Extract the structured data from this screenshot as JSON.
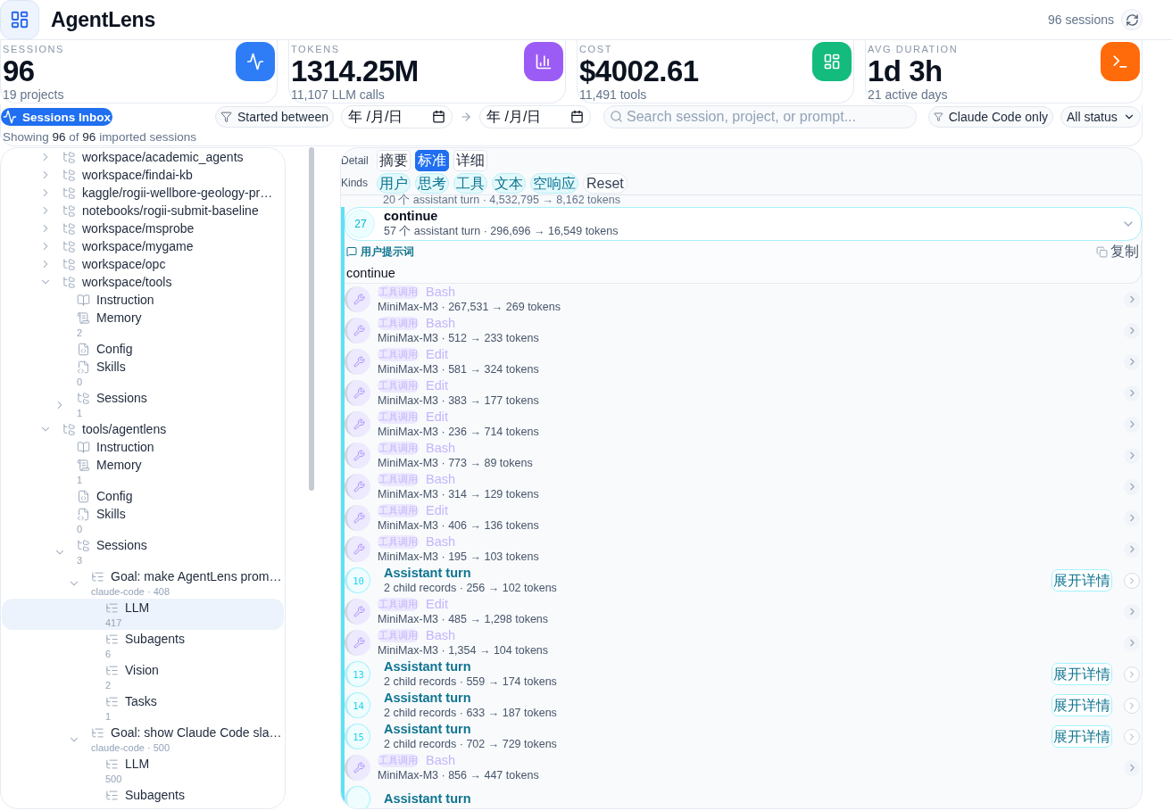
{
  "app": {
    "title": "AgentLens",
    "session_count": "96 sessions"
  },
  "stats": [
    {
      "kind": "activity",
      "label": "SESSIONS",
      "value": "96",
      "note": "19 projects",
      "color": "#2f7df6"
    },
    {
      "kind": "chart",
      "label": "TOKENS",
      "value": "1314.25M",
      "note": "11,107 LLM calls",
      "color": "#9b5cf6"
    },
    {
      "kind": "grid",
      "label": "COST",
      "value": "$4002.61",
      "note": "11,491 tools",
      "color": "#13bb7c"
    },
    {
      "kind": "terminal",
      "label": "AVG DURATION",
      "value": "1d 3h",
      "note": "21 active days",
      "color": "#ff6a0a"
    }
  ],
  "toolbar": {
    "inbox": "Sessions Inbox",
    "date_filter": "Started between",
    "date_from": {
      "placeholder": "年 /月/日"
    },
    "date_to": {
      "placeholder": "年 /月/日"
    },
    "search": {
      "placeholder": "Search session, project, or prompt..."
    },
    "source_filter": "Claude Code only",
    "status": "All status",
    "summary": "Showing **96** of **96** imported sessions"
  },
  "tree": [
    {
      "kind": "project",
      "label": "workspace/academic_agents",
      "expanded": false,
      "selected": false
    },
    {
      "kind": "project",
      "label": "workspace/findai-kb",
      "expanded": false,
      "selected": false
    },
    {
      "kind": "project",
      "label": "kaggle/rogii-wellbore-geology-pr…",
      "expanded": false,
      "selected": false
    },
    {
      "kind": "project",
      "label": "notebooks/rogii-submit-baseline",
      "expanded": false,
      "selected": false
    },
    {
      "kind": "project",
      "label": "workspace/msprobe",
      "expanded": false,
      "selected": false
    },
    {
      "kind": "project",
      "label": "workspace/mygame",
      "expanded": false,
      "selected": false
    },
    {
      "kind": "project",
      "label": "workspace/opc",
      "expanded": false,
      "selected": false
    },
    {
      "kind": "project",
      "label": "workspace/tools",
      "expanded": true,
      "selected": false,
      "children": [
        {
          "kind": "instruction",
          "label": "Instruction",
          "selected": false
        },
        {
          "kind": "memory",
          "label": "Memory",
          "count": "2",
          "selected": false
        },
        {
          "kind": "config",
          "label": "Config",
          "selected": false
        },
        {
          "kind": "skills",
          "label": "Skills",
          "count": "0",
          "selected": false
        },
        {
          "kind": "sessions",
          "label": "Sessions",
          "count": "1",
          "expanded": false,
          "selected": false
        }
      ]
    },
    {
      "kind": "project",
      "label": "tools/agentlens",
      "expanded": true,
      "selected": false,
      "children": [
        {
          "kind": "instruction",
          "label": "Instruction",
          "selected": false
        },
        {
          "kind": "memory",
          "label": "Memory",
          "count": "1",
          "selected": false
        },
        {
          "kind": "config",
          "label": "Config",
          "selected": false
        },
        {
          "kind": "skills",
          "label": "Skills",
          "count": "0",
          "selected": false
        },
        {
          "kind": "sessions",
          "label": "Sessions",
          "count": "3",
          "expanded": true,
          "selected": false,
          "children": [
            {
              "kind": "session",
              "label": "Goal: make AgentLens prom…",
              "meta": "claude-code · 408",
              "expanded": true,
              "selected": false,
              "children": [
                {
                  "kind": "category",
                  "label": "LLM",
                  "count": "417",
                  "selected": true
                },
                {
                  "kind": "category",
                  "label": "Subagents",
                  "count": "6",
                  "selected": false
                },
                {
                  "kind": "category",
                  "label": "Vision",
                  "count": "2",
                  "selected": false
                },
                {
                  "kind": "category",
                  "label": "Tasks",
                  "count": "1",
                  "selected": false
                }
              ]
            },
            {
              "kind": "session",
              "label": "Goal: show Claude Code sla…",
              "meta": "claude-code · 500",
              "expanded": true,
              "selected": false,
              "children": [
                {
                  "kind": "category",
                  "label": "LLM",
                  "count": "500",
                  "selected": false
                },
                {
                  "kind": "category",
                  "label": "Subagents",
                  "selected": false
                }
              ]
            }
          ]
        }
      ]
    }
  ],
  "detail": {
    "label": "Detail",
    "options": [
      {
        "label": "摘要",
        "selected": false
      },
      {
        "label": "标准",
        "selected": true
      },
      {
        "label": "详细",
        "selected": false
      }
    ]
  },
  "kinds": {
    "label": "Kinds",
    "options": [
      {
        "label": "用户",
        "selected": true
      },
      {
        "label": "思考",
        "selected": true
      },
      {
        "label": "工具",
        "selected": true
      },
      {
        "label": "文本",
        "selected": true
      },
      {
        "label": "空响应",
        "selected": true
      }
    ],
    "reset": "Reset"
  },
  "timeline": {
    "previous_meta": "20 个 assistant turn · 4,532,795 → 8,162 tokens",
    "turn": {
      "number": "27",
      "title": "continue",
      "meta": "57 个 assistant turn · 296,696 → 16,549 tokens",
      "expanded": true,
      "prompt_label": "用户提示词",
      "copy": "复制",
      "prompt": "continue"
    },
    "steps": [
      {
        "kind": "tool",
        "tag": "工具调用",
        "name": "Bash",
        "meta": "MiniMax-M3 · 267,531 → 269 tokens"
      },
      {
        "kind": "tool",
        "tag": "工具调用",
        "name": "Bash",
        "meta": "MiniMax-M3 · 512 → 233 tokens"
      },
      {
        "kind": "tool",
        "tag": "工具调用",
        "name": "Edit",
        "meta": "MiniMax-M3 · 581 → 324 tokens"
      },
      {
        "kind": "tool",
        "tag": "工具调用",
        "name": "Edit",
        "meta": "MiniMax-M3 · 383 → 177 tokens"
      },
      {
        "kind": "tool",
        "tag": "工具调用",
        "name": "Edit",
        "meta": "MiniMax-M3 · 236 → 714 tokens"
      },
      {
        "kind": "tool",
        "tag": "工具调用",
        "name": "Bash",
        "meta": "MiniMax-M3 · 773 → 89 tokens"
      },
      {
        "kind": "tool",
        "tag": "工具调用",
        "name": "Bash",
        "meta": "MiniMax-M3 · 314 → 129 tokens"
      },
      {
        "kind": "tool",
        "tag": "工具调用",
        "name": "Edit",
        "meta": "MiniMax-M3 · 406 → 136 tokens"
      },
      {
        "kind": "tool",
        "tag": "工具调用",
        "name": "Bash",
        "meta": "MiniMax-M3 · 195 → 103 tokens"
      },
      {
        "kind": "turn",
        "number": "10",
        "title": "Assistant turn",
        "meta": "2 child records · 256 → 102 tokens",
        "action": "展开详情"
      },
      {
        "kind": "tool",
        "tag": "工具调用",
        "name": "Edit",
        "meta": "MiniMax-M3 · 485 → 1,298 tokens"
      },
      {
        "kind": "tool",
        "tag": "工具调用",
        "name": "Bash",
        "meta": "MiniMax-M3 · 1,354 → 104 tokens"
      },
      {
        "kind": "turn",
        "number": "13",
        "title": "Assistant turn",
        "meta": "2 child records · 559 → 174 tokens",
        "action": "展开详情"
      },
      {
        "kind": "turn",
        "number": "14",
        "title": "Assistant turn",
        "meta": "2 child records · 633 → 187 tokens",
        "action": "展开详情"
      },
      {
        "kind": "turn",
        "number": "15",
        "title": "Assistant turn",
        "meta": "2 child records · 702 → 729 tokens",
        "action": "展开详情"
      },
      {
        "kind": "tool",
        "tag": "工具调用",
        "name": "Bash",
        "meta": "MiniMax-M3 · 856 → 447 tokens"
      },
      {
        "kind": "turn",
        "title": "Assistant turn"
      }
    ]
  }
}
